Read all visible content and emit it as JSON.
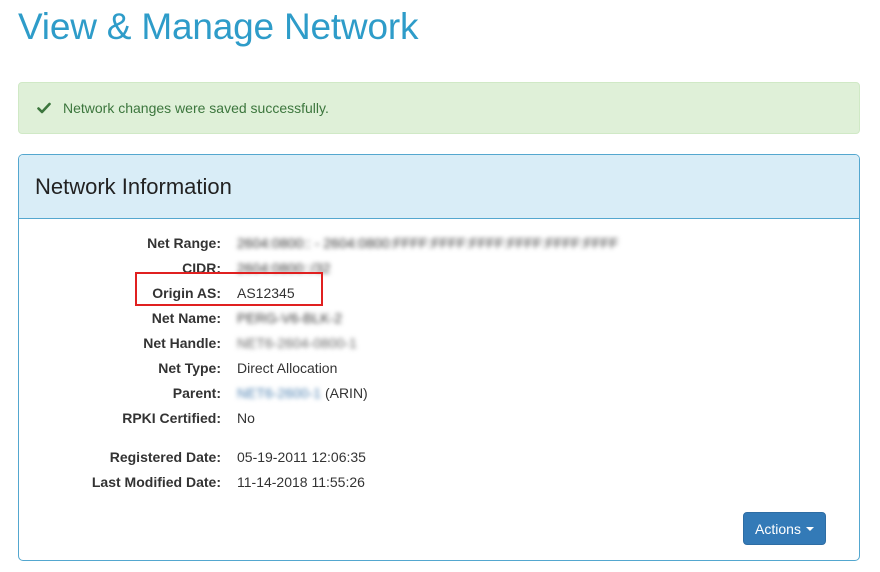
{
  "page": {
    "title": "View & Manage Network"
  },
  "alert": {
    "message": "Network changes were saved successfully.",
    "icon": "check-icon",
    "color": "#3c763d"
  },
  "panel": {
    "title": "Network Information"
  },
  "fields": {
    "net_range": {
      "label": "Net Range:",
      "value": "2604:0800:: - 2604:0800:FFFF:FFFF:FFFF:FFFF:FFFF:FFFF"
    },
    "cidr": {
      "label": "CIDR:",
      "value": "2604:0800::/32"
    },
    "origin_as": {
      "label": "Origin AS:",
      "value": "AS12345"
    },
    "net_name": {
      "label": "Net Name:",
      "value": "PERG-V6-BLK-2"
    },
    "net_handle": {
      "label": "Net Handle:",
      "value": "NET6-2604-0800-1"
    },
    "net_type": {
      "label": "Net Type:",
      "value": "Direct Allocation"
    },
    "parent": {
      "label": "Parent:",
      "link": "NET6-2600-1",
      "suffix": "(ARIN)"
    },
    "rpki": {
      "label": "RPKI Certified:",
      "value": "No"
    },
    "registered": {
      "label": "Registered Date:",
      "value": "05-19-2011 12:06:35"
    },
    "modified": {
      "label": "Last Modified Date:",
      "value": "11-14-2018 11:55:26"
    }
  },
  "actions": {
    "label": "Actions"
  },
  "colors": {
    "title": "#2e9cc9",
    "panel_border": "#54a7cf",
    "panel_heading": "#d9edf7",
    "highlight": "#e02020",
    "button": "#337ab7"
  }
}
